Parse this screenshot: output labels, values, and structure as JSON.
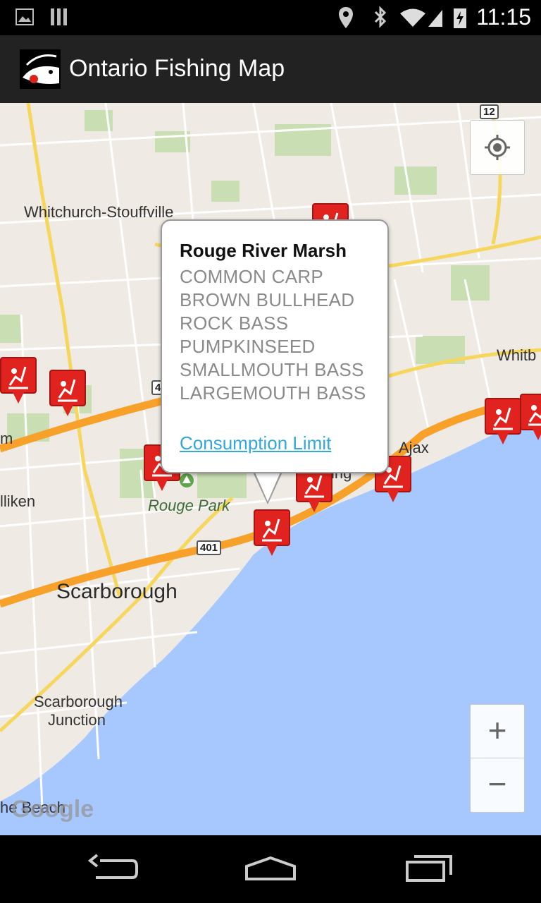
{
  "status_bar": {
    "time": "11:15"
  },
  "app": {
    "title": "Ontario Fishing Map"
  },
  "map": {
    "places": [
      {
        "id": "whitchurch",
        "text": "Whitchurch-Stouffville"
      },
      {
        "id": "whitby",
        "text": "Whitb"
      },
      {
        "id": "ajax",
        "text": "Ajax"
      },
      {
        "id": "ring",
        "text": "ing"
      },
      {
        "id": "m",
        "text": "m"
      },
      {
        "id": "milliken",
        "text": "lliken"
      },
      {
        "id": "rouge_park",
        "text": "Rouge Park"
      },
      {
        "id": "scarborough",
        "text": "Scarborough"
      },
      {
        "id": "scarb_junction_1",
        "text": "Scarborough"
      },
      {
        "id": "scarb_junction_2",
        "text": "Junction"
      },
      {
        "id": "beach",
        "text": "he Beach"
      }
    ],
    "highway_shields": [
      "12",
      "401",
      "4"
    ],
    "attribution": "Google",
    "zoom_in": "+",
    "zoom_out": "−"
  },
  "info_window": {
    "title": "Rouge River Marsh",
    "species": [
      "COMMON CARP",
      "BROWN BULLHEAD",
      "ROCK BASS",
      "PUMPKINSEED",
      "SMALLMOUTH BASS",
      "LARGEMOUTH BASS"
    ],
    "link": "Consumption Limit"
  },
  "colors": {
    "marker_red": "#e0231f",
    "water": "#a6c8ff",
    "highway": "#f7a02a",
    "link": "#33a7d8"
  }
}
